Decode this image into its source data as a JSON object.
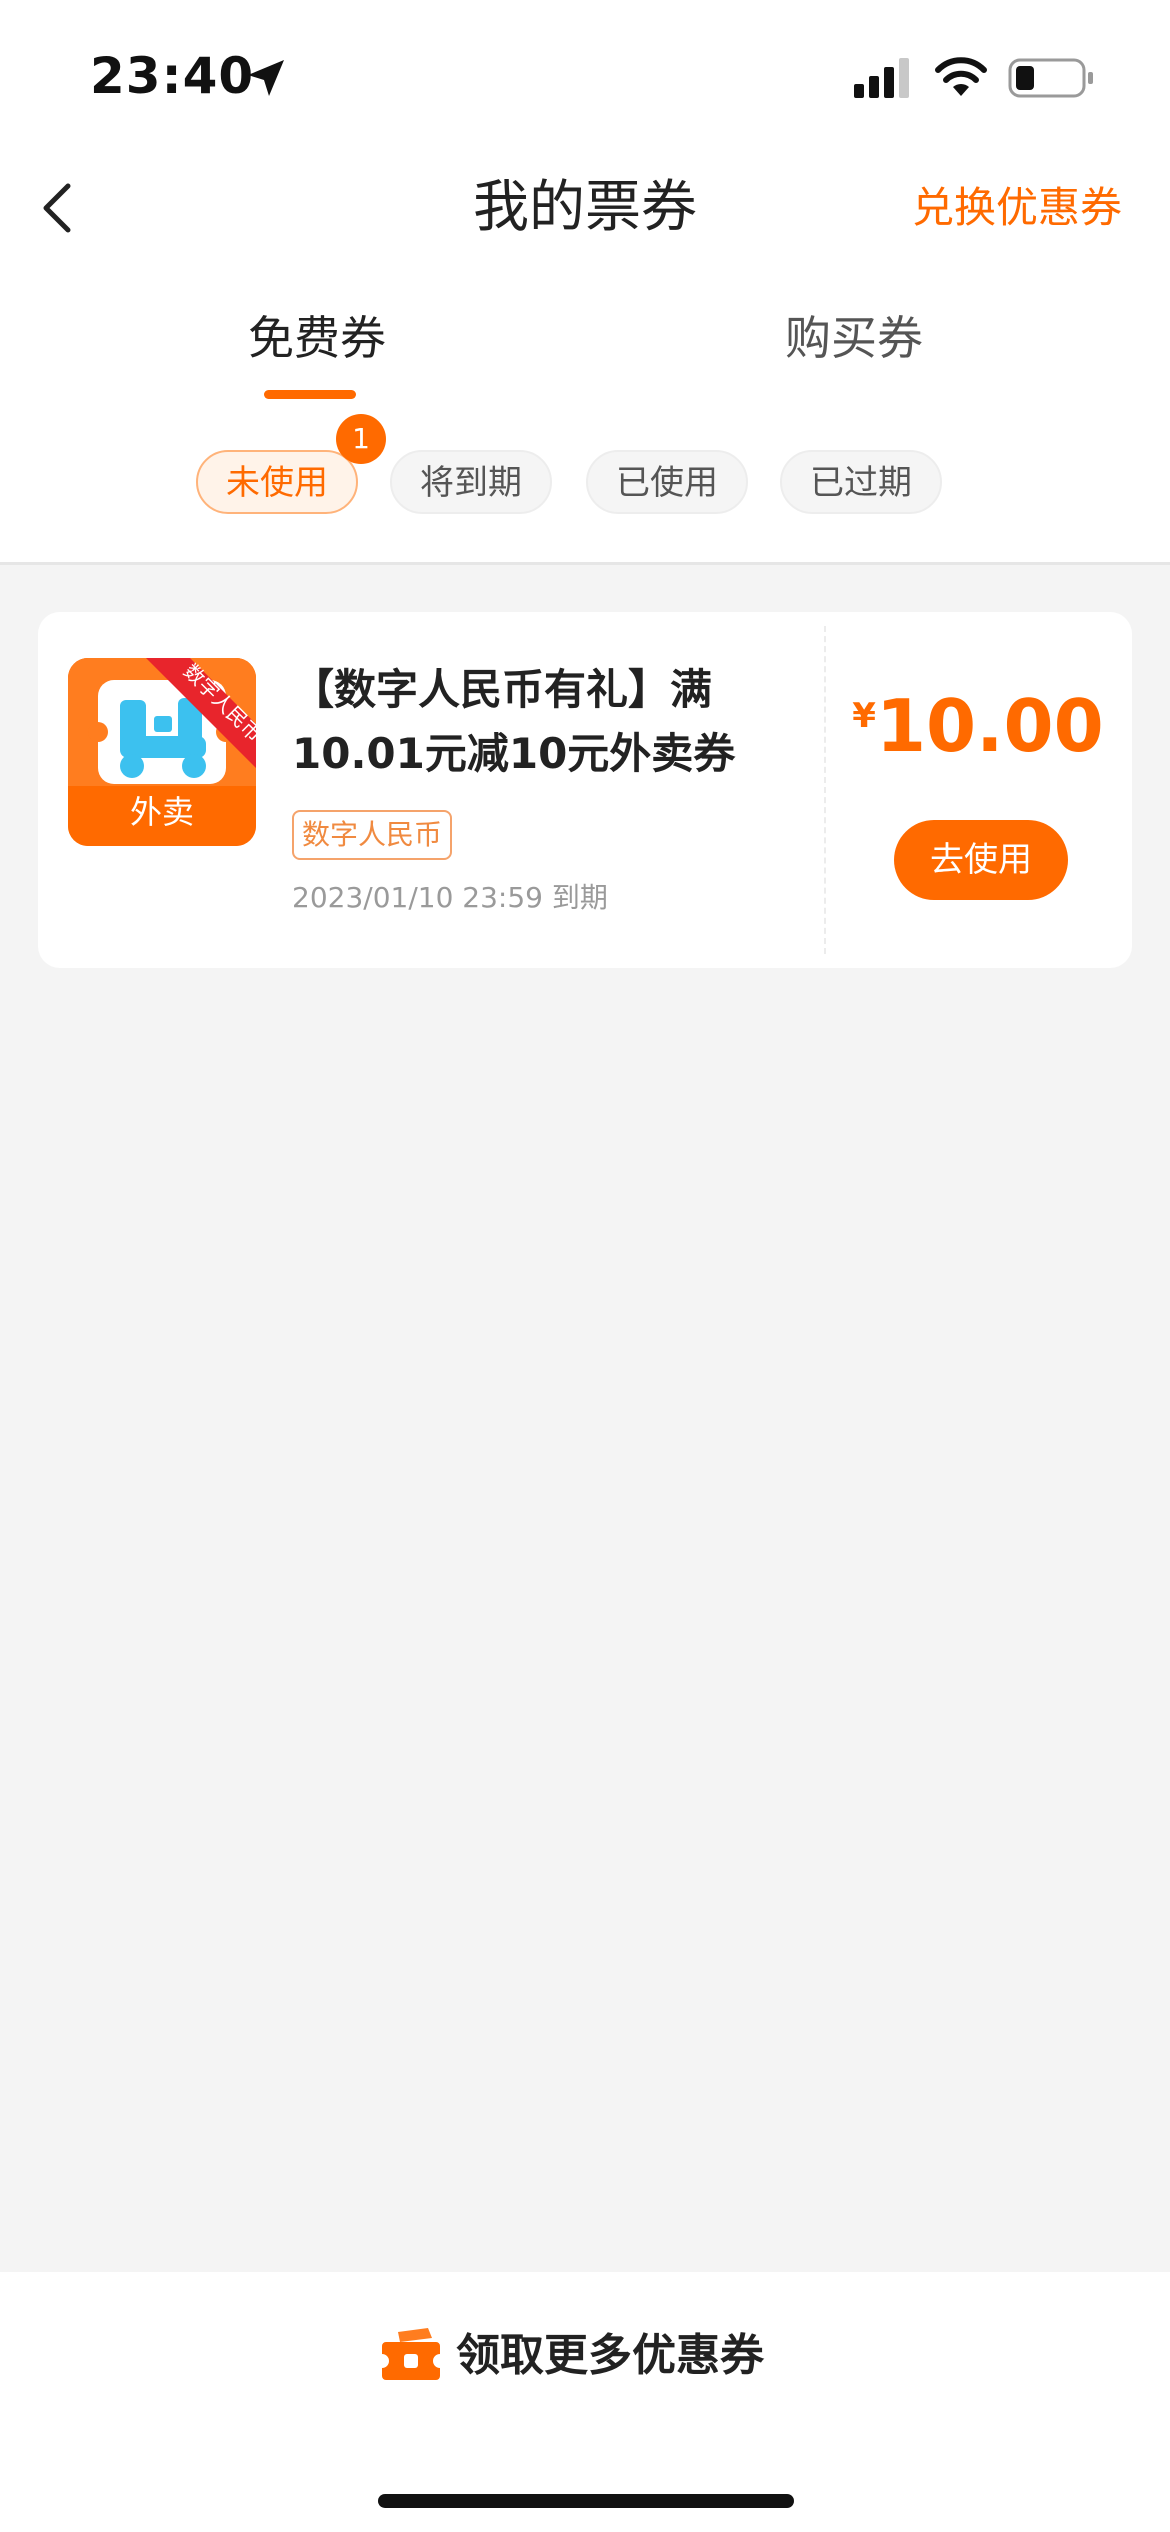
{
  "status_bar": {
    "time": "23:40",
    "icons": [
      "location-arrow-icon",
      "cellular-signal-icon",
      "wifi-icon",
      "battery-icon"
    ]
  },
  "nav": {
    "back_icon": "chevron-left-icon",
    "title": "我的票券",
    "action": "兑换优惠券"
  },
  "main_tabs": [
    {
      "label": "免费券",
      "active": true
    },
    {
      "label": "购买券",
      "active": false
    }
  ],
  "filter_chips": [
    {
      "label": "未使用",
      "active": true,
      "badge": "1"
    },
    {
      "label": "将到期",
      "active": false
    },
    {
      "label": "已使用",
      "active": false
    },
    {
      "label": "已过期",
      "active": false
    }
  ],
  "coupon": {
    "logo": {
      "ribbon": "数字人民币专属",
      "label": "外卖",
      "icon": "scooter-icon"
    },
    "title": "【数字人民币有礼】满10.01元减10元外卖券",
    "tag": "数字人民币",
    "expiry": "2023/01/10 23:59 到期",
    "currency_symbol": "¥",
    "amount": "10.00",
    "button": "去使用"
  },
  "bottom": {
    "icon": "ticket-icon",
    "label": "领取更多优惠券"
  },
  "colors": {
    "accent": "#ff6a00",
    "background": "#f4f4f4",
    "card": "#ffffff"
  }
}
